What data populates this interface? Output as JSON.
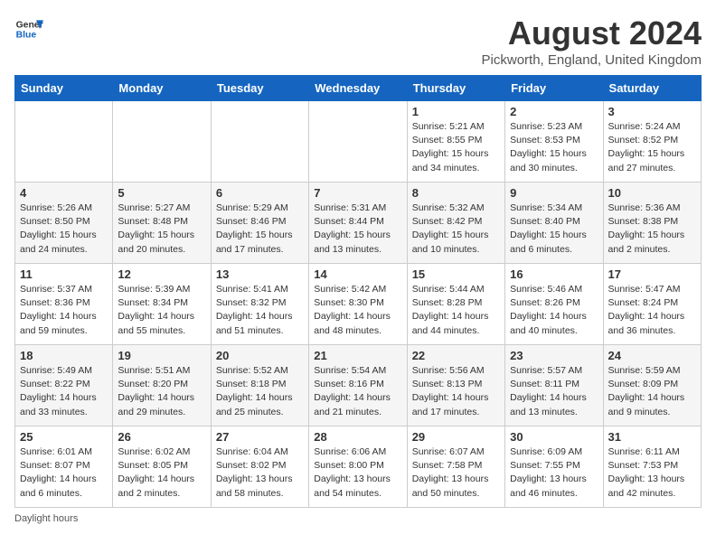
{
  "header": {
    "logo_line1": "General",
    "logo_line2": "Blue",
    "month_title": "August 2024",
    "location": "Pickworth, England, United Kingdom"
  },
  "columns": [
    "Sunday",
    "Monday",
    "Tuesday",
    "Wednesday",
    "Thursday",
    "Friday",
    "Saturday"
  ],
  "weeks": [
    [
      {
        "day": "",
        "info": ""
      },
      {
        "day": "",
        "info": ""
      },
      {
        "day": "",
        "info": ""
      },
      {
        "day": "",
        "info": ""
      },
      {
        "day": "1",
        "info": "Sunrise: 5:21 AM\nSunset: 8:55 PM\nDaylight: 15 hours\nand 34 minutes."
      },
      {
        "day": "2",
        "info": "Sunrise: 5:23 AM\nSunset: 8:53 PM\nDaylight: 15 hours\nand 30 minutes."
      },
      {
        "day": "3",
        "info": "Sunrise: 5:24 AM\nSunset: 8:52 PM\nDaylight: 15 hours\nand 27 minutes."
      }
    ],
    [
      {
        "day": "4",
        "info": "Sunrise: 5:26 AM\nSunset: 8:50 PM\nDaylight: 15 hours\nand 24 minutes."
      },
      {
        "day": "5",
        "info": "Sunrise: 5:27 AM\nSunset: 8:48 PM\nDaylight: 15 hours\nand 20 minutes."
      },
      {
        "day": "6",
        "info": "Sunrise: 5:29 AM\nSunset: 8:46 PM\nDaylight: 15 hours\nand 17 minutes."
      },
      {
        "day": "7",
        "info": "Sunrise: 5:31 AM\nSunset: 8:44 PM\nDaylight: 15 hours\nand 13 minutes."
      },
      {
        "day": "8",
        "info": "Sunrise: 5:32 AM\nSunset: 8:42 PM\nDaylight: 15 hours\nand 10 minutes."
      },
      {
        "day": "9",
        "info": "Sunrise: 5:34 AM\nSunset: 8:40 PM\nDaylight: 15 hours\nand 6 minutes."
      },
      {
        "day": "10",
        "info": "Sunrise: 5:36 AM\nSunset: 8:38 PM\nDaylight: 15 hours\nand 2 minutes."
      }
    ],
    [
      {
        "day": "11",
        "info": "Sunrise: 5:37 AM\nSunset: 8:36 PM\nDaylight: 14 hours\nand 59 minutes."
      },
      {
        "day": "12",
        "info": "Sunrise: 5:39 AM\nSunset: 8:34 PM\nDaylight: 14 hours\nand 55 minutes."
      },
      {
        "day": "13",
        "info": "Sunrise: 5:41 AM\nSunset: 8:32 PM\nDaylight: 14 hours\nand 51 minutes."
      },
      {
        "day": "14",
        "info": "Sunrise: 5:42 AM\nSunset: 8:30 PM\nDaylight: 14 hours\nand 48 minutes."
      },
      {
        "day": "15",
        "info": "Sunrise: 5:44 AM\nSunset: 8:28 PM\nDaylight: 14 hours\nand 44 minutes."
      },
      {
        "day": "16",
        "info": "Sunrise: 5:46 AM\nSunset: 8:26 PM\nDaylight: 14 hours\nand 40 minutes."
      },
      {
        "day": "17",
        "info": "Sunrise: 5:47 AM\nSunset: 8:24 PM\nDaylight: 14 hours\nand 36 minutes."
      }
    ],
    [
      {
        "day": "18",
        "info": "Sunrise: 5:49 AM\nSunset: 8:22 PM\nDaylight: 14 hours\nand 33 minutes."
      },
      {
        "day": "19",
        "info": "Sunrise: 5:51 AM\nSunset: 8:20 PM\nDaylight: 14 hours\nand 29 minutes."
      },
      {
        "day": "20",
        "info": "Sunrise: 5:52 AM\nSunset: 8:18 PM\nDaylight: 14 hours\nand 25 minutes."
      },
      {
        "day": "21",
        "info": "Sunrise: 5:54 AM\nSunset: 8:16 PM\nDaylight: 14 hours\nand 21 minutes."
      },
      {
        "day": "22",
        "info": "Sunrise: 5:56 AM\nSunset: 8:13 PM\nDaylight: 14 hours\nand 17 minutes."
      },
      {
        "day": "23",
        "info": "Sunrise: 5:57 AM\nSunset: 8:11 PM\nDaylight: 14 hours\nand 13 minutes."
      },
      {
        "day": "24",
        "info": "Sunrise: 5:59 AM\nSunset: 8:09 PM\nDaylight: 14 hours\nand 9 minutes."
      }
    ],
    [
      {
        "day": "25",
        "info": "Sunrise: 6:01 AM\nSunset: 8:07 PM\nDaylight: 14 hours\nand 6 minutes."
      },
      {
        "day": "26",
        "info": "Sunrise: 6:02 AM\nSunset: 8:05 PM\nDaylight: 14 hours\nand 2 minutes."
      },
      {
        "day": "27",
        "info": "Sunrise: 6:04 AM\nSunset: 8:02 PM\nDaylight: 13 hours\nand 58 minutes."
      },
      {
        "day": "28",
        "info": "Sunrise: 6:06 AM\nSunset: 8:00 PM\nDaylight: 13 hours\nand 54 minutes."
      },
      {
        "day": "29",
        "info": "Sunrise: 6:07 AM\nSunset: 7:58 PM\nDaylight: 13 hours\nand 50 minutes."
      },
      {
        "day": "30",
        "info": "Sunrise: 6:09 AM\nSunset: 7:55 PM\nDaylight: 13 hours\nand 46 minutes."
      },
      {
        "day": "31",
        "info": "Sunrise: 6:11 AM\nSunset: 7:53 PM\nDaylight: 13 hours\nand 42 minutes."
      }
    ]
  ],
  "footer": {
    "note": "Daylight hours"
  }
}
